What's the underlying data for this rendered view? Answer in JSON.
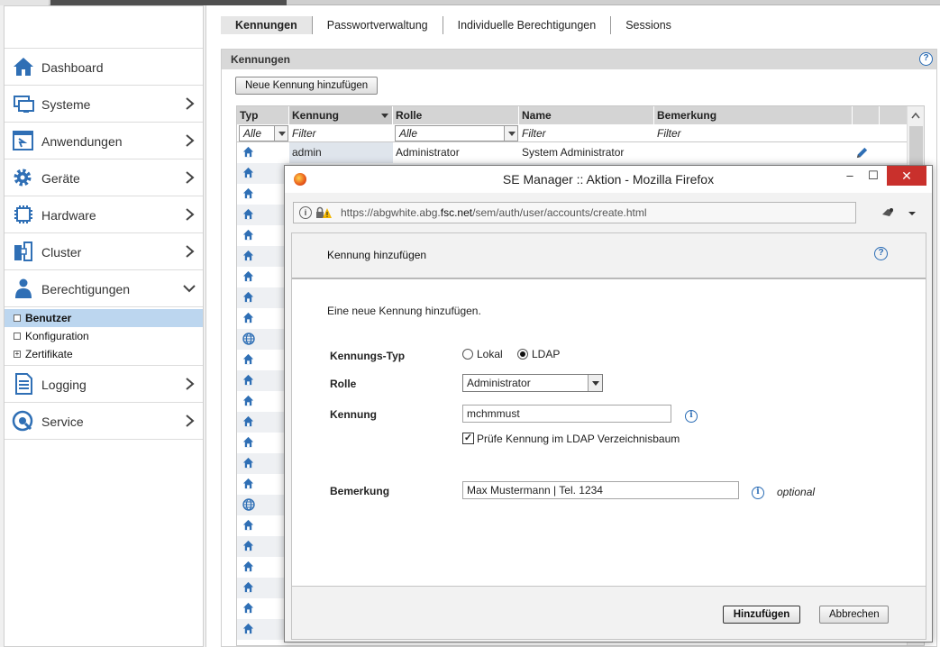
{
  "sidebar": {
    "items": [
      {
        "label": "Dashboard",
        "icon": "home-icon"
      },
      {
        "label": "Systeme",
        "icon": "monitor-icon"
      },
      {
        "label": "Anwendungen",
        "icon": "application-icon"
      },
      {
        "label": "Geräte",
        "icon": "gear-icon"
      },
      {
        "label": "Hardware",
        "icon": "chip-icon"
      },
      {
        "label": "Cluster",
        "icon": "cluster-icon"
      },
      {
        "label": "Berechtigungen",
        "icon": "user-icon"
      },
      {
        "label": "Logging",
        "icon": "document-icon"
      },
      {
        "label": "Service",
        "icon": "service-icon"
      }
    ],
    "subitems": [
      {
        "label": "Benutzer"
      },
      {
        "label": "Konfiguration"
      },
      {
        "label": "Zertifikate"
      }
    ],
    "accent": "#2a6cb5",
    "active_bg": "#bcd6ef"
  },
  "tabs": [
    {
      "label": "Kennungen"
    },
    {
      "label": "Passwortverwaltung"
    },
    {
      "label": "Individuelle Berechtigungen"
    },
    {
      "label": "Sessions"
    }
  ],
  "panel": {
    "title": "Kennungen",
    "add_button": "Neue Kennung hinzufügen",
    "help": "?"
  },
  "table": {
    "headers": [
      "Typ",
      "Kennung",
      "Rolle",
      "Name",
      "Bemerkung"
    ],
    "filters": {
      "typ": "Alle",
      "kennung": "Filter",
      "rolle": "Alle",
      "name": "Filter",
      "bemerkung": "Filter"
    },
    "first_row": {
      "kennung": "admin",
      "rolle": "Administrator",
      "name": "System Administrator"
    },
    "row_types": [
      "local",
      "local",
      "local",
      "local",
      "local",
      "local",
      "local",
      "local",
      "local",
      "ldap",
      "local",
      "local",
      "local",
      "local",
      "local",
      "local",
      "local",
      "ldap",
      "local",
      "local",
      "local",
      "local",
      "local",
      "local"
    ]
  },
  "popup": {
    "window_title": "SE Manager :: Aktion - Mozilla Firefox",
    "url_prefix": "https://abgwhite.abg.",
    "url_domain": "fsc.net",
    "url_path": "/sem/auth/user/accounts/create.html",
    "minimize": "–",
    "maximize": "☐",
    "close": "✕",
    "header_title": "Kennung hinzufügen",
    "help": "?",
    "intro": "Eine neue Kennung hinzufügen.",
    "labels": {
      "typ": "Kennungs-Typ",
      "rolle": "Rolle",
      "kennung": "Kennung",
      "bemerkung": "Bemerkung"
    },
    "typ_options": {
      "lokal": "Lokal",
      "ldap": "LDAP",
      "selected": "LDAP"
    },
    "rolle_value": "Administrator",
    "kennung_value": "mchmmust",
    "checkbox_label": "Prüfe Kennung im LDAP Verzeichnisbaum",
    "checkbox_checked": true,
    "bemerkung_value": "Max Mustermann | Tel. 1234",
    "optional": "optional",
    "info": "i",
    "submit": "Hinzufügen",
    "cancel": "Abbrechen"
  }
}
